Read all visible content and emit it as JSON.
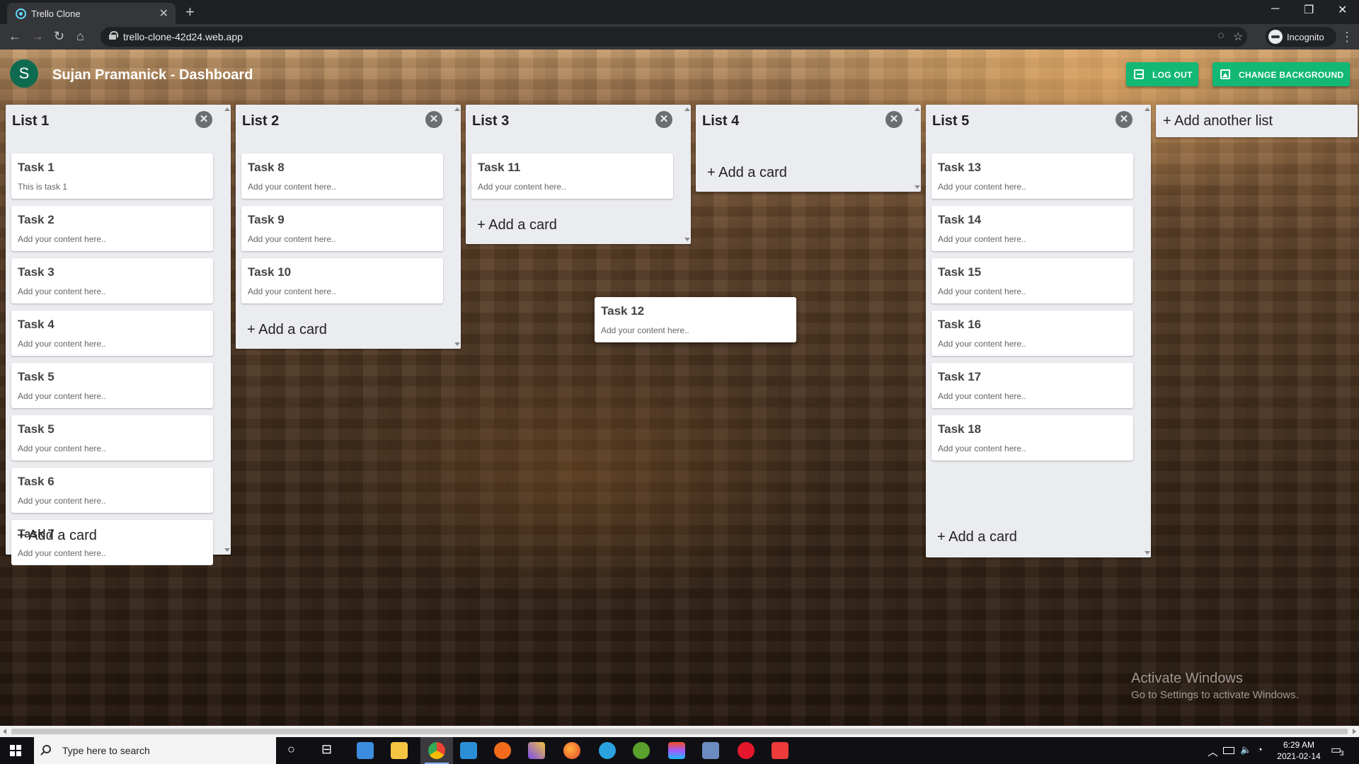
{
  "browser": {
    "tab_title": "Trello Clone",
    "tab_close": "✕",
    "new_tab": "+",
    "url": "trello-clone-42d24.web.app",
    "profile_label": "Incognito",
    "win_minimize": "─",
    "win_restore": "❐",
    "win_close": "✕",
    "nav_back": "←",
    "nav_forward": "→",
    "nav_reload": "↻",
    "nav_home": "⌂",
    "eye_icon": "◌",
    "star_icon": "☆",
    "menu_icon": "⋮"
  },
  "header": {
    "avatar_letter": "S",
    "title": "Sujan Pramanick - Dashboard",
    "logout_label": "LOG OUT",
    "change_bg_label": "CHANGE BACKGROUND"
  },
  "board": {
    "close_glyph": "✕",
    "add_list_label": "+ Add another list",
    "lists": [
      {
        "title": "List 1",
        "add_label": "+ Add a card",
        "cards": [
          {
            "title": "Task 1",
            "desc": "This is task 1"
          },
          {
            "title": "Task 2",
            "desc": "Add your content here.."
          },
          {
            "title": "Task 3",
            "desc": "Add your content here.."
          },
          {
            "title": "Task 4",
            "desc": "Add your content here.."
          },
          {
            "title": "Task 5",
            "desc": "Add your content here.."
          },
          {
            "title": "Task 5",
            "desc": "Add your content here.."
          },
          {
            "title": "Task 6",
            "desc": "Add your content here.."
          },
          {
            "title": "Task 7",
            "desc": "Add your content here.."
          }
        ]
      },
      {
        "title": "List 2",
        "add_label": "+ Add a card",
        "cards": [
          {
            "title": "Task 8",
            "desc": "Add your content here.."
          },
          {
            "title": "Task 9",
            "desc": "Add your content here.."
          },
          {
            "title": "Task 10",
            "desc": "Add your content here.."
          }
        ]
      },
      {
        "title": "List 3",
        "add_label": "+ Add a card",
        "cards": [
          {
            "title": "Task 11",
            "desc": "Add your content here.."
          }
        ]
      },
      {
        "title": "List 4",
        "add_label": "+ Add a card",
        "cards": []
      },
      {
        "title": "List 5",
        "add_label": "+ Add a card",
        "cards": [
          {
            "title": "Task 13",
            "desc": "Add your content here.."
          },
          {
            "title": "Task 14",
            "desc": "Add your content here.."
          },
          {
            "title": "Task 15",
            "desc": "Add your content here.."
          },
          {
            "title": "Task 16",
            "desc": "Add your content here.."
          },
          {
            "title": "Task 17",
            "desc": "Add your content here.."
          },
          {
            "title": "Task 18",
            "desc": "Add your content here.."
          }
        ]
      }
    ],
    "dragging_card": {
      "title": "Task 12",
      "desc": "Add your content here.."
    }
  },
  "watermark": {
    "line1": "Activate Windows",
    "line2": "Go to Settings to activate Windows."
  },
  "taskbar": {
    "search_placeholder": "Type here to search",
    "time": "6:29 AM",
    "date": "2021-02-14",
    "notification_count": "3",
    "tray_chevron": "︿",
    "cortana_icon": "○",
    "taskview_icon": "⊟"
  },
  "colors": {
    "accent_green": "#12b874",
    "avatar_bg": "#0e6b4f",
    "list_bg": "#ebecf0"
  }
}
